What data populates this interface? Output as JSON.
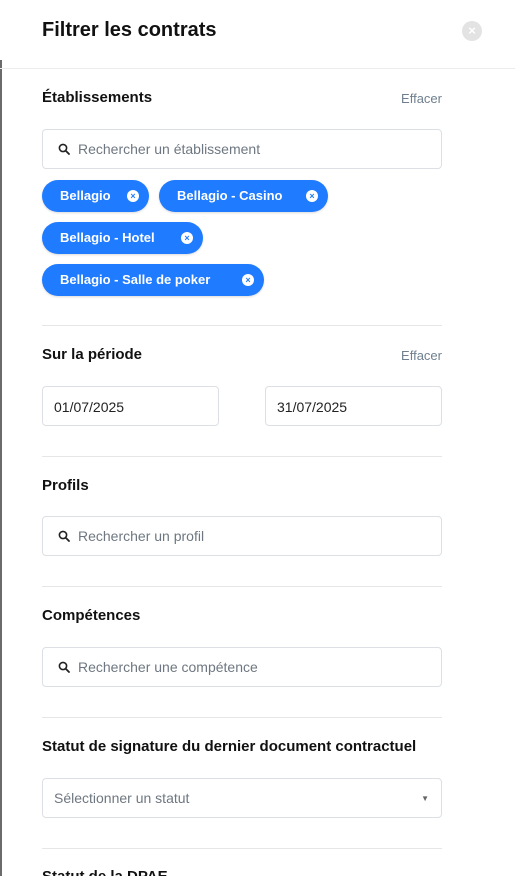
{
  "header": {
    "title": "Filtrer les contrats",
    "close_glyph": "×"
  },
  "etablissements": {
    "title": "Établissements",
    "clear_label": "Effacer",
    "search_placeholder": "Rechercher un établissement",
    "chips": [
      "Bellagio",
      "Bellagio - Casino",
      "Bellagio - Hotel",
      "Bellagio - Salle de poker"
    ],
    "chip_remove_glyph": "×"
  },
  "periode": {
    "title": "Sur la période",
    "clear_label": "Effacer",
    "start_date": "01/07/2025",
    "end_date": "31/07/2025"
  },
  "profils": {
    "title": "Profils",
    "search_placeholder": "Rechercher un profil"
  },
  "competences": {
    "title": "Compétences",
    "search_placeholder": "Rechercher une compétence"
  },
  "statut_signature": {
    "title": "Statut de signature du dernier document contractuel",
    "select_placeholder": "Sélectionner un statut",
    "caret_glyph": "▼"
  },
  "statut_dpae": {
    "title": "Statut de la DPAE"
  },
  "colors": {
    "accent": "#1f7bff",
    "muted_text": "#6e7781"
  }
}
